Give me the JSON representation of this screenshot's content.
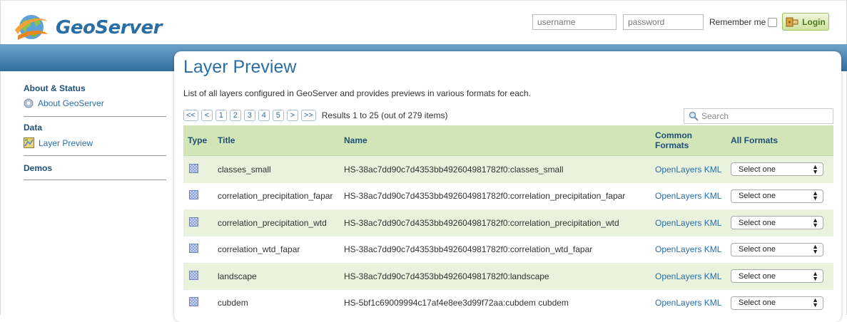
{
  "header": {
    "logo_text": "GeoServer",
    "username_placeholder": "username",
    "password_placeholder": "password",
    "remember_label": "Remember me",
    "login_label": "Login"
  },
  "sidebar": {
    "sections": [
      {
        "title": "About & Status",
        "items": [
          {
            "label": "About GeoServer",
            "icon": "info-globe-icon"
          }
        ]
      },
      {
        "title": "Data",
        "items": [
          {
            "label": "Layer Preview",
            "icon": "map-preview-icon"
          }
        ]
      },
      {
        "title": "Demos",
        "items": []
      }
    ]
  },
  "main": {
    "title": "Layer Preview",
    "description": "List of all layers configured in GeoServer and provides previews in various formats for each.",
    "pager": {
      "first": "<<",
      "prev": "<",
      "pages": [
        "1",
        "2",
        "3",
        "4",
        "5"
      ],
      "next": ">",
      "last": ">>",
      "results": "Results 1 to 25 (out of 279 items)"
    },
    "search_placeholder": "Search",
    "table": {
      "columns": {
        "type": "Type",
        "title": "Title",
        "name": "Name",
        "common_formats": "Common Formats",
        "all_formats": "All Formats"
      },
      "rows": [
        {
          "title": "classes_small",
          "name": "HS-38ac7dd90c7d4353bb492604981782f0:classes_small",
          "openlayers": "OpenLayers",
          "kml": "KML",
          "select": "Select one"
        },
        {
          "title": "correlation_precipitation_fapar",
          "name": "HS-38ac7dd90c7d4353bb492604981782f0:correlation_precipitation_fapar",
          "openlayers": "OpenLayers",
          "kml": "KML",
          "select": "Select one"
        },
        {
          "title": "correlation_precipitation_wtd",
          "name": "HS-38ac7dd90c7d4353bb492604981782f0:correlation_precipitation_wtd",
          "openlayers": "OpenLayers",
          "kml": "KML",
          "select": "Select one"
        },
        {
          "title": "correlation_wtd_fapar",
          "name": "HS-38ac7dd90c7d4353bb492604981782f0:correlation_wtd_fapar",
          "openlayers": "OpenLayers",
          "kml": "KML",
          "select": "Select one"
        },
        {
          "title": "landscape",
          "name": "HS-38ac7dd90c7d4353bb492604981782f0:landscape",
          "openlayers": "OpenLayers",
          "kml": "KML",
          "select": "Select one"
        },
        {
          "title": "cubdem",
          "name": "HS-5bf1c69009994c17af4e8ee3d99f72aa:cubdem cubdem",
          "openlayers": "OpenLayers",
          "kml": "KML",
          "select": "Select one"
        }
      ]
    }
  },
  "colors": {
    "brand_blue": "#2a6ea6",
    "band_top": "#6fa3c9",
    "band_bottom": "#2f6f9e",
    "table_header": "#d2e5b6",
    "row_alt": "#e9f2dc",
    "login_green": "#cfe39d"
  }
}
